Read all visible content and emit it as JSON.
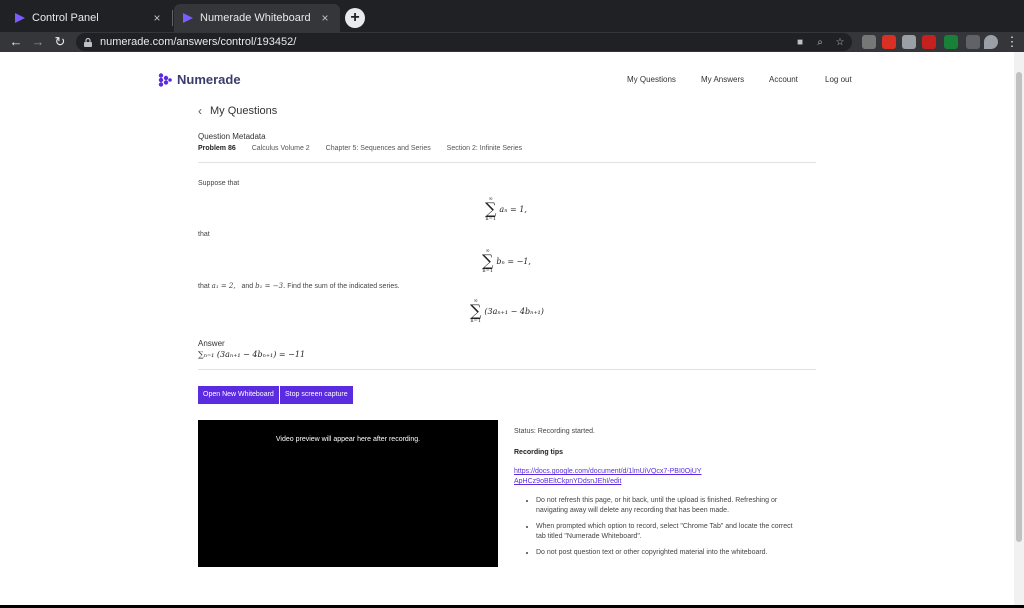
{
  "browser": {
    "tabs": [
      {
        "title": "Control Panel",
        "close": "×"
      },
      {
        "title": "Numerade Whiteboard",
        "close": "×"
      }
    ],
    "new_tab": "+",
    "url": "numerade.com/answers/control/193452/",
    "nav": {
      "back": "←",
      "forward": "→",
      "reload": "↻"
    }
  },
  "site": {
    "brand": "Numerade",
    "brand_color": "#5b2be0",
    "nav": [
      "My Questions",
      "My Answers",
      "Account",
      "Log out"
    ]
  },
  "back_link": {
    "icon": "‹",
    "label": "My Questions"
  },
  "metadata": {
    "title": "Question Metadata",
    "problem": "Problem 86",
    "book": "Calculus Volume 2",
    "chapter": "Chapter 5: Sequences and Series",
    "section": "Section 2: Infinite Series"
  },
  "problem": {
    "intro": "Suppose that",
    "eq1": "aₙ = 1,",
    "connector": "that",
    "eq2": "bₙ = −1,",
    "conditions_prefix": "that",
    "cond_a": "a₁ = 2,",
    "cond_mid": "and",
    "cond_b": "b₁ = −3.",
    "conditions_suffix": "Find the sum of the indicated series.",
    "eq3": "(3aₙ₊₁ − 4bₙ₊₁)",
    "sum_sup": "∞",
    "sum_sub": "n=1"
  },
  "answer": {
    "label": "Answer",
    "expression": "∑ₙ₌₁ (3aₙ₊₁ − 4bₙ₊₁) = −11"
  },
  "buttons": {
    "open_whiteboard": "Open New Whiteboard",
    "stop_capture": "Stop screen capture"
  },
  "video": {
    "placeholder": "Video preview will appear here after recording."
  },
  "recording": {
    "status": "Status: Recording started.",
    "tips_title": "Recording tips",
    "link": "https://docs.google.com/document/d/1lmUiVQcx7-PBI0OjUYApHCz9oBEltCkpnYDdsnJEhI/edit",
    "tips": [
      "Do not refresh this page, or hit back, until the upload is finished. Refreshing or navigating away will delete any recording that has been made.",
      "When prompted which option to record, select \"Chrome Tab\" and locate the correct tab titled \"Numerade Whiteboard\".",
      "Do not post question text or other copyrighted material into the whiteboard."
    ]
  }
}
